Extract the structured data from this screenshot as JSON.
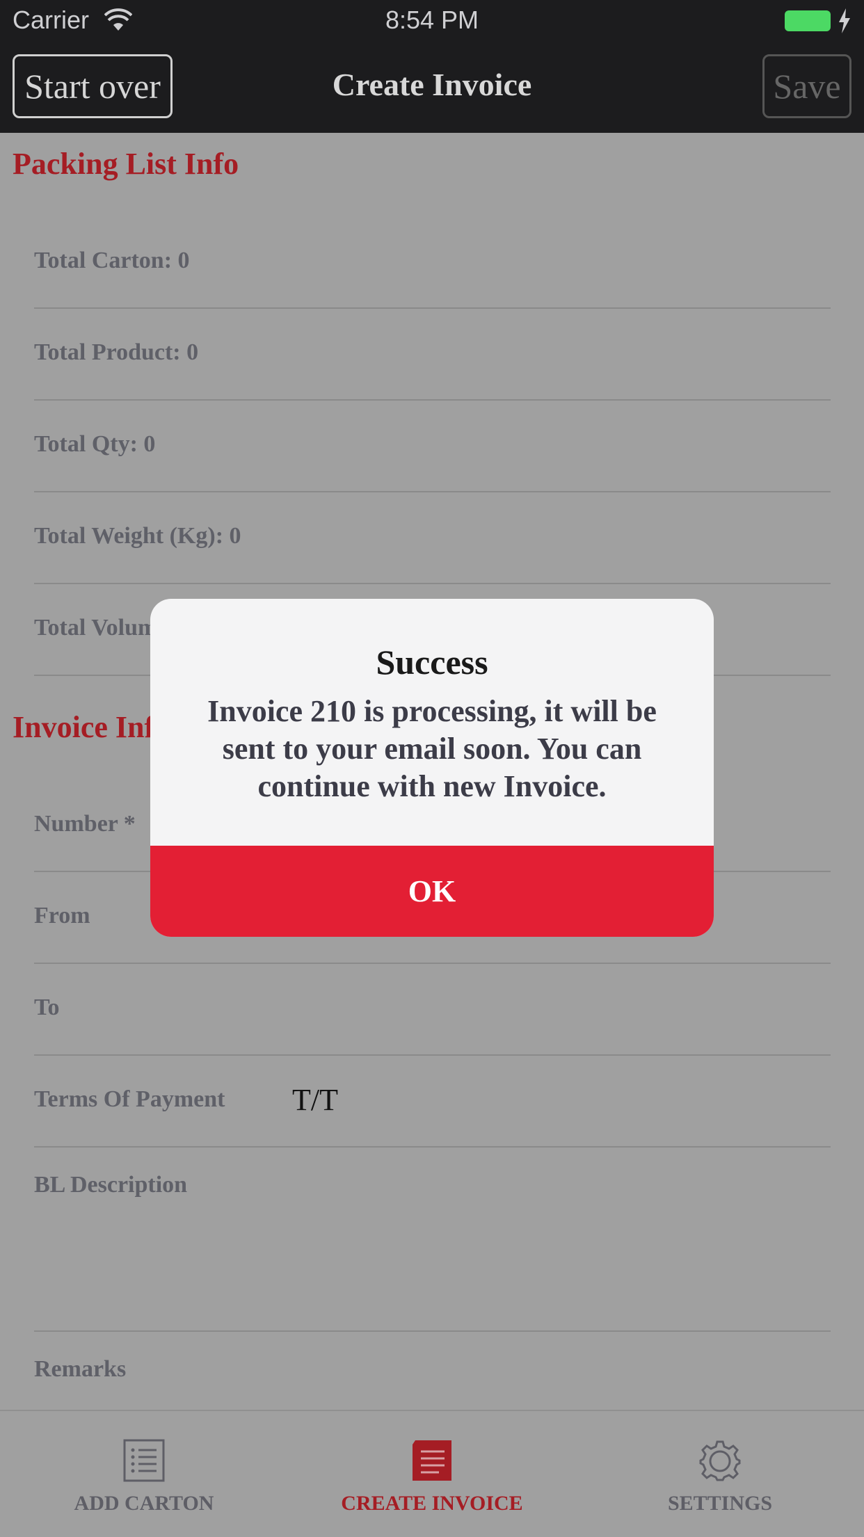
{
  "status_bar": {
    "carrier": "Carrier",
    "time": "8:54 PM"
  },
  "nav": {
    "start_over": "Start over",
    "title": "Create Invoice",
    "save": "Save"
  },
  "packing_section": {
    "title": "Packing List Info",
    "rows": [
      {
        "label": "Total Carton: 0"
      },
      {
        "label": "Total Product: 0"
      },
      {
        "label": "Total Qty: 0"
      },
      {
        "label": "Total Weight (Kg): 0"
      },
      {
        "label": "Total Volume"
      }
    ]
  },
  "invoice_section": {
    "title": "Invoice Info",
    "number_label": "Number *",
    "from_label": "From",
    "to_label": "To",
    "terms_label": "Terms Of Payment",
    "terms_value": "T/T",
    "bl_label": "BL Description",
    "remarks_label": "Remarks"
  },
  "tabs": [
    {
      "label": "ADD CARTON",
      "icon": "list-icon",
      "active": false
    },
    {
      "label": "CREATE INVOICE",
      "icon": "invoice-icon",
      "active": true
    },
    {
      "label": "SETTINGS",
      "icon": "gear-icon",
      "active": false
    }
  ],
  "alert": {
    "title": "Success",
    "message": "Invoice 210 is processing, it will be sent to your email soon. You can continue with new Invoice.",
    "ok": "OK"
  },
  "colors": {
    "accent": "#a51d24",
    "alert_button": "#e31f34",
    "battery": "#4cd964"
  }
}
